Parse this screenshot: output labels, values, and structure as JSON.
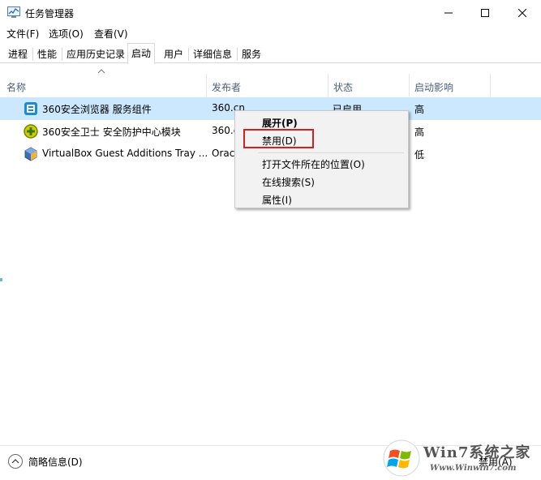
{
  "window": {
    "title": "任务管理器"
  },
  "menu": [
    {
      "label": "文件(F)"
    },
    {
      "label": "选项(O)"
    },
    {
      "label": "查看(V)"
    }
  ],
  "tabs": [
    {
      "label": "进程"
    },
    {
      "label": "性能"
    },
    {
      "label": "应用历史记录"
    },
    {
      "label": "启动",
      "active": true
    },
    {
      "label": "用户"
    },
    {
      "label": "详细信息"
    },
    {
      "label": "服务"
    }
  ],
  "columns": {
    "name": "名称",
    "publisher": "发布者",
    "status": "状态",
    "impact": "启动影响"
  },
  "rows": [
    {
      "icon": "360-browser-icon",
      "name": "360安全浏览器 服务组件",
      "publisher": "360.cn",
      "status": "已启用",
      "impact": "高",
      "selected": true
    },
    {
      "icon": "360-safeguard-icon",
      "name": "360安全卫士 安全防护中心模块",
      "publisher": "360.cn",
      "status": "",
      "impact": "高"
    },
    {
      "icon": "virtualbox-icon",
      "name": "VirtualBox Guest Additions Tray ...",
      "publisher": "Oracle Corporation",
      "status": "",
      "impact": "低"
    }
  ],
  "context_menu": {
    "expand": "展开(P)",
    "disable": "禁用(D)",
    "open_location": "打开文件所在的位置(O)",
    "search_online": "在线搜索(S)",
    "properties": "属性(I)"
  },
  "footer": {
    "fewer_details": "简略信息(D)",
    "disable_button": "禁用(A)"
  },
  "watermark": {
    "title": "Win7系统之家",
    "url": "Www.Winwin7.com"
  },
  "colors": {
    "selected_row": "#cce8ff",
    "highlight_box": "#d32020",
    "header_text": "#4c607a"
  }
}
